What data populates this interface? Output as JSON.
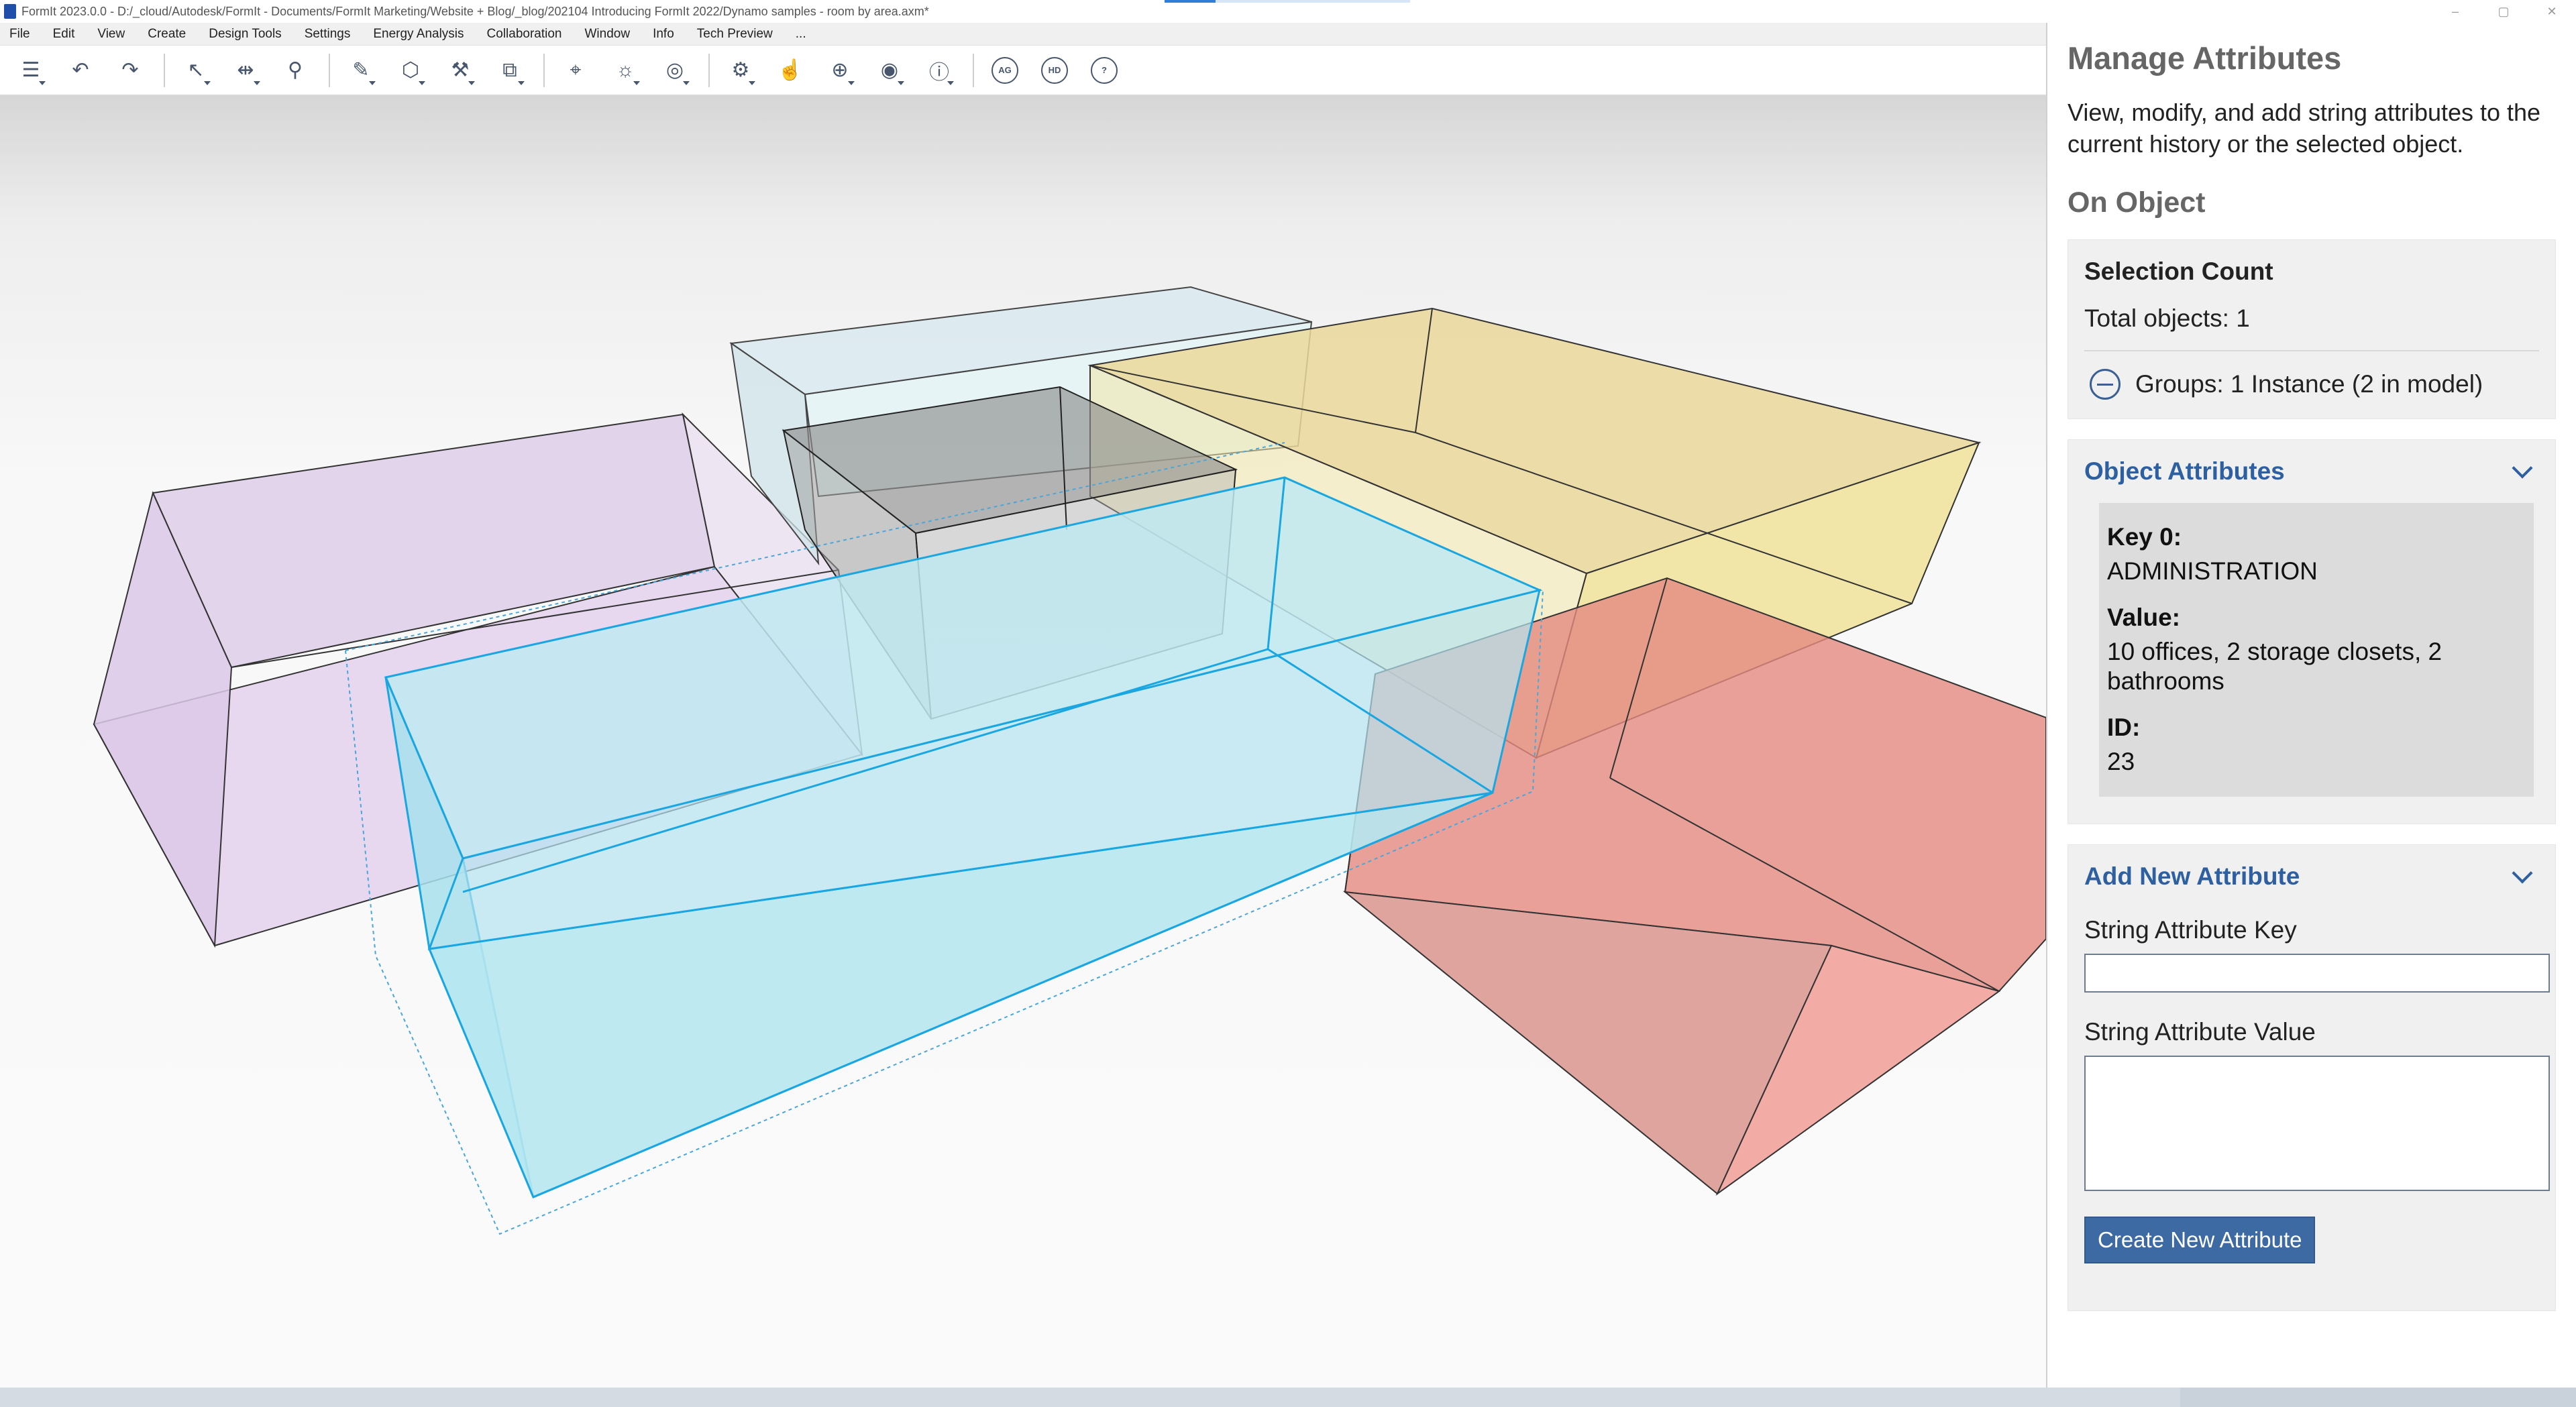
{
  "window": {
    "title": "FormIt 2023.0.0 - D:/_cloud/Autodesk/FormIt - Documents/FormIt Marketing/Website + Blog/_blog/202104 Introducing FormIt 2022/Dynamo samples - room by area.axm*",
    "controls": [
      "–",
      "▢",
      "✕"
    ]
  },
  "menu": [
    "File",
    "Edit",
    "View",
    "Create",
    "Design Tools",
    "Settings",
    "Energy Analysis",
    "Collaboration",
    "Window",
    "Info",
    "Tech Preview",
    "..."
  ],
  "toolbar": {
    "icons": [
      {
        "name": "layers-icon",
        "glyph": "☰",
        "dropdown": true
      },
      {
        "name": "undo-icon",
        "glyph": "↶",
        "dropdown": false
      },
      {
        "name": "redo-icon",
        "glyph": "↷",
        "dropdown": false
      },
      {
        "name": "select-icon",
        "glyph": "↖",
        "dropdown": true
      },
      {
        "name": "measure-icon",
        "glyph": "⇹",
        "dropdown": true
      },
      {
        "name": "paint-icon",
        "glyph": "⚲",
        "dropdown": false
      },
      {
        "name": "draw-icon",
        "glyph": "✎",
        "dropdown": true
      },
      {
        "name": "solid-icon",
        "glyph": "⬡",
        "dropdown": true
      },
      {
        "name": "edit-geometry-icon",
        "glyph": "⚒",
        "dropdown": true
      },
      {
        "name": "group-icon",
        "glyph": "⧉",
        "dropdown": true
      },
      {
        "name": "location-icon",
        "glyph": "⌖",
        "dropdown": false
      },
      {
        "name": "sun-icon",
        "glyph": "☼",
        "dropdown": true
      },
      {
        "name": "energy-icon",
        "glyph": "◎",
        "dropdown": true
      },
      {
        "name": "settings-icon",
        "glyph": "⚙",
        "dropdown": true
      },
      {
        "name": "touch-icon",
        "glyph": "☝",
        "dropdown": false
      },
      {
        "name": "collaborate-icon",
        "glyph": "⊕",
        "dropdown": true
      },
      {
        "name": "user-icon",
        "glyph": "◉",
        "dropdown": true
      },
      {
        "name": "info-icon",
        "glyph": "ⓘ",
        "dropdown": true
      }
    ],
    "badges": [
      "AG",
      "HD",
      "?"
    ]
  },
  "panel": {
    "title": "Manage Attributes",
    "description": "View, modify, and add string attributes to the current history or the selected object.",
    "section": "On Object",
    "selection": {
      "heading": "Selection Count",
      "total": "Total objects: 1",
      "groups": "Groups: 1 Instance (2 in model)"
    },
    "object_attributes": {
      "heading": "Object Attributes",
      "key_label": "Key 0:",
      "key_value": "ADMINISTRATION",
      "value_label": "Value:",
      "value_value": "10 offices, 2 storage closets, 2 bathrooms",
      "id_label": "ID:",
      "id_value": "23"
    },
    "add_new": {
      "heading": "Add New Attribute",
      "key_label": "String Attribute Key",
      "key_value": "",
      "value_label": "String Attribute Value",
      "value_value": "",
      "button": "Create New Attribute"
    }
  },
  "colors": {
    "accent": "#2e5fa0",
    "button": "#3d6aa3",
    "selected_box": "#1aa6e0",
    "purple_box": "#d8c4e4",
    "yellow_box": "#ecdb9a",
    "red_box": "#e8877c",
    "gray_box": "#9a9a9a",
    "light_blue_box": "#cfe3ea"
  }
}
